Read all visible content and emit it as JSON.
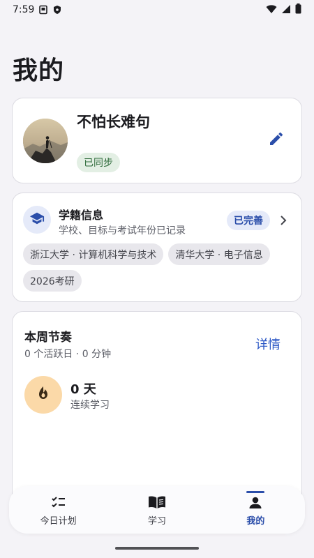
{
  "status_bar": {
    "time": "7:59",
    "icons": [
      "sim-card-icon",
      "shield-icon",
      "wifi-icon",
      "signal-icon",
      "battery-icon"
    ]
  },
  "page": {
    "title": "我的"
  },
  "profile": {
    "name": "不怕长难句",
    "sync_status": "已同步",
    "avatar_icon": "avatar-mountain-hiker",
    "edit_icon": "pencil-icon"
  },
  "academic": {
    "title": "学籍信息",
    "subtitle": "学校、目标与考试年份已记录",
    "status": "已完善",
    "icon": "graduation-cap-icon",
    "chips": [
      {
        "label": "浙江大学 · 计算机科学与技术"
      },
      {
        "label": "清华大学 · 电子信息"
      },
      {
        "label": "2026考研"
      }
    ]
  },
  "weekly": {
    "title": "本周节奏",
    "summary": "0 个活跃日 · 0 分钟",
    "details_label": "详情",
    "streak_value": "0 天",
    "streak_label": "连续学习",
    "streak_icon": "flame-icon"
  },
  "bottom_nav": {
    "items": [
      {
        "label": "今日计划",
        "icon": "checklist-icon",
        "active": false
      },
      {
        "label": "学习",
        "icon": "open-book-icon",
        "active": false
      },
      {
        "label": "我的",
        "icon": "person-icon",
        "active": true
      }
    ]
  },
  "colors": {
    "background": "#f4f3f7",
    "accent": "#2b4eaa",
    "link": "#2b57c5",
    "sync_badge_bg": "#e3efe4",
    "sync_badge_text": "#2e6b3a",
    "streak_icon_bg": "#fbd9a8"
  }
}
